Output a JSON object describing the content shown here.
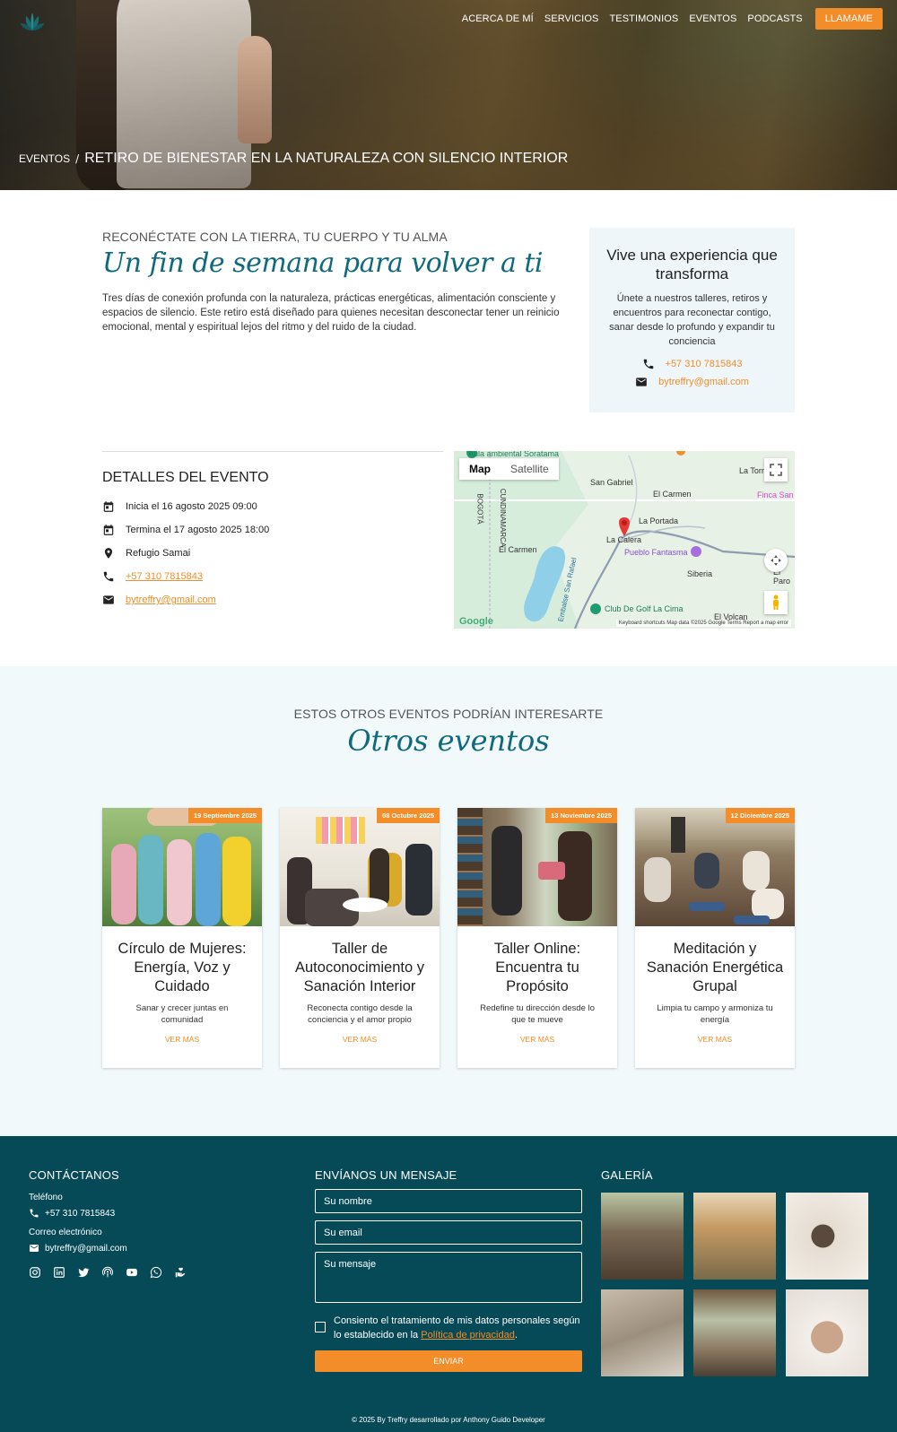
{
  "nav": {
    "items": [
      "ACERCA DE MÍ",
      "SERVICIOS",
      "TESTIMONIOS",
      "EVENTOS",
      "PODCASTS"
    ],
    "cta": "LLAMAME"
  },
  "breadcrumb": {
    "parent": "EVENTOS",
    "separator": "/",
    "current": "RETIRO DE BIENESTAR EN LA NATURALEZA CON SILENCIO INTERIOR"
  },
  "intro": {
    "kicker": "RECONÉCTATE CON LA TIERRA, TU CUERPO Y TU ALMA",
    "headline": "Un fin de semana para volver a ti",
    "body": "Tres días de conexión profunda con la naturaleza, prácticas energéticas, alimentación consciente y espacios de silencio. Este retiro está diseñado para quienes necesitan desconectar tener un reinicio emocional, mental y espiritual lejos del ritmo y del ruido de la ciudad."
  },
  "cta_box": {
    "title": "Vive una experiencia que transforma",
    "text": "Únete a nuestros talleres, retiros y encuentros para reconectar contigo, sanar desde lo profundo y expandir tu conciencia",
    "phone": "+57 310 7815843",
    "email": "bytreffry@gmail.com"
  },
  "details": {
    "title": "DETALLES DEL EVENTO",
    "start": "Inicia el 16 agosto 2025 09:00",
    "end": "Termina el 17 agosto 2025 18:00",
    "place": "Refugio Samai",
    "phone": "+57 310 7815843",
    "email": "bytreffry@gmail.com"
  },
  "map": {
    "tab_map": "Map",
    "tab_satellite": "Satellite",
    "labels": [
      "Aula ambiental Soratama",
      "San Gabriel",
      "El Carmen",
      "La Portada",
      "La Calera",
      "Pueblo Fantasma",
      "El Carmen",
      "Siberia",
      "Club De Golf La Cima",
      "El Volcan",
      "La Torr",
      "Finca San",
      "El Paro",
      "Embalse San Rafael",
      "CUNDINAMARCA",
      "BOGOTÁ"
    ],
    "attribution": "Keyboard shortcuts   Map data ©2025 Google   Terms   Report a map error",
    "logo": "Google"
  },
  "others": {
    "kicker": "ESTOS OTROS EVENTOS PODRÍAN INTERESARTE",
    "title": "Otros eventos",
    "cards": [
      {
        "date": "19 Septiembre 2025",
        "title": "Círculo de Mujeres: Energía, Voz y Cuidado",
        "text": "Sanar y crecer juntas en comunidad",
        "more": "VER MÁS"
      },
      {
        "date": "08 Octubre 2025",
        "title": "Taller de Autoconocimiento y Sanación Interior",
        "text": "Reconecta contigo desde la conciencia y el amor propio",
        "more": "VER MÁS"
      },
      {
        "date": "13 Noviembre 2025",
        "title": "Taller Online: Encuentra tu Propósito",
        "text": "Redefine tu dirección desde lo que te mueve",
        "more": "VER MÁS"
      },
      {
        "date": "12 Diciembre 2025",
        "title": "Meditación y Sanación Energética Grupal",
        "text": "Limpia tu campo y armoniza tu energía",
        "more": "VER MÁS"
      }
    ]
  },
  "footer": {
    "contact_title": "CONTÁCTANOS",
    "phone_label": "Teléfono",
    "phone": "+57 310 7815843",
    "email_label": "Correo electrónico",
    "email": "bytreffry@gmail.com",
    "form_title": "ENVÍANOS UN MENSAJE",
    "name_placeholder": "Su nombre",
    "email_placeholder": "Su email",
    "message_placeholder": "Su mensaje",
    "consent_text": "Consiento el tratamiento de mis datos personales según lo establecido en la",
    "policy_link": "Política de privacidad",
    "consent_end": ".",
    "send": "ENVIAR",
    "gallery_title": "GALERÍA",
    "copyright": "© 2025 By Treffry desarrollado por Anthony Guido Developer"
  },
  "colors": {
    "accent": "#f28d2a",
    "brand": "#064a57",
    "script": "#106a7e",
    "tint": "#f2f9fb"
  }
}
